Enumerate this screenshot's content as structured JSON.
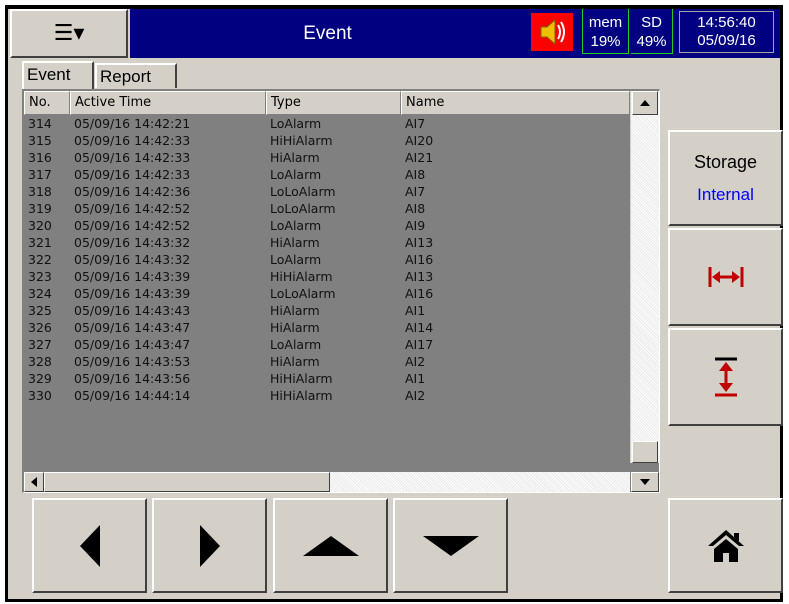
{
  "header": {
    "menu_glyph": "☰▾",
    "title": "Event",
    "mem_label": "mem",
    "mem_value": "19%",
    "sd_label": "SD",
    "sd_value": "49%",
    "time": "14:56:40",
    "date": "05/09/16",
    "colors": {
      "title_bar": "#000080",
      "speaker_bg": "#ff0000"
    }
  },
  "tabs": [
    {
      "label": "Event",
      "active": true
    },
    {
      "label": "Report",
      "active": false
    }
  ],
  "table": {
    "columns": [
      "No.",
      "Active Time",
      "Type",
      "Name"
    ],
    "rows": [
      [
        "314",
        "05/09/16 14:42:21",
        "LoAlarm",
        "AI7"
      ],
      [
        "315",
        "05/09/16 14:42:33",
        "HiHiAlarm",
        "AI20"
      ],
      [
        "316",
        "05/09/16 14:42:33",
        "HiAlarm",
        "AI21"
      ],
      [
        "317",
        "05/09/16 14:42:33",
        "LoAlarm",
        "AI8"
      ],
      [
        "318",
        "05/09/16 14:42:36",
        "LoLoAlarm",
        "AI7"
      ],
      [
        "319",
        "05/09/16 14:42:52",
        "LoLoAlarm",
        "AI8"
      ],
      [
        "320",
        "05/09/16 14:42:52",
        "LoAlarm",
        "AI9"
      ],
      [
        "321",
        "05/09/16 14:43:32",
        "HiAlarm",
        "AI13"
      ],
      [
        "322",
        "05/09/16 14:43:32",
        "LoAlarm",
        "AI16"
      ],
      [
        "323",
        "05/09/16 14:43:39",
        "HiHiAlarm",
        "AI13"
      ],
      [
        "324",
        "05/09/16 14:43:39",
        "LoLoAlarm",
        "AI16"
      ],
      [
        "325",
        "05/09/16 14:43:43",
        "HiAlarm",
        "AI1"
      ],
      [
        "326",
        "05/09/16 14:43:47",
        "HiAlarm",
        "AI14"
      ],
      [
        "327",
        "05/09/16 14:43:47",
        "LoAlarm",
        "AI17"
      ],
      [
        "328",
        "05/09/16 14:43:53",
        "HiAlarm",
        "AI2"
      ],
      [
        "329",
        "05/09/16 14:43:56",
        "HiHiAlarm",
        "AI1"
      ],
      [
        "330",
        "05/09/16 14:44:14",
        "HiHiAlarm",
        "AI2"
      ]
    ]
  },
  "side": {
    "storage_label": "Storage",
    "storage_value": "Internal",
    "icons": [
      "expand-horizontal-icon",
      "expand-vertical-icon"
    ]
  },
  "bottom": {
    "icons": [
      "arrow-left-icon",
      "arrow-right-icon",
      "arrow-up-icon",
      "arrow-down-icon",
      "home-icon"
    ]
  }
}
